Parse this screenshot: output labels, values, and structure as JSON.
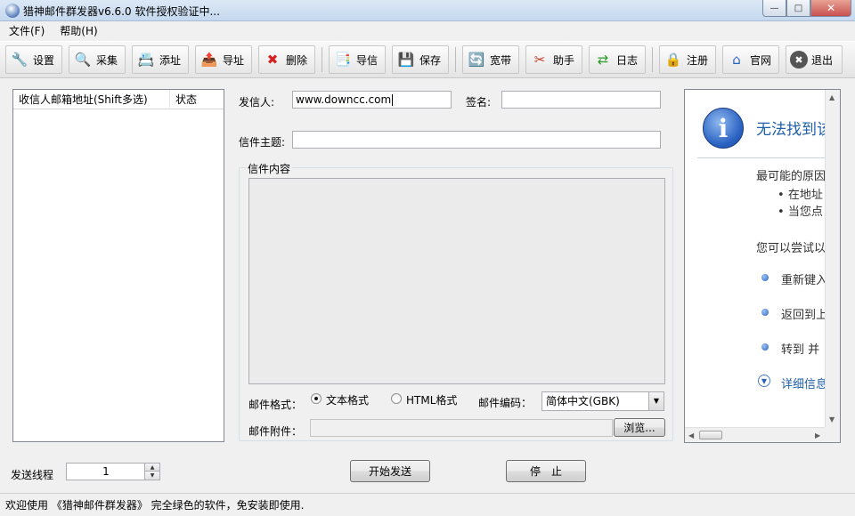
{
  "window": {
    "title": "猎神邮件群发器v6.6.0 软件授权验证中...",
    "controls": {
      "minimize": "—",
      "maximize": "□",
      "close": "✕"
    }
  },
  "menu": [
    "文件(F)",
    "帮助(H)"
  ],
  "toolbar": [
    {
      "label": "设置",
      "icon": "wrench-icon",
      "glyph": "🔧",
      "color": "#5a6b7d"
    },
    {
      "label": "采集",
      "icon": "magnifier-icon",
      "glyph": "🔍",
      "color": "#2a62c2"
    },
    {
      "label": "添址",
      "icon": "add-address-icon",
      "glyph": "📇",
      "color": "#2a62c2"
    },
    {
      "label": "导址",
      "icon": "export-address-icon",
      "glyph": "📤",
      "color": "#2a7d2a"
    },
    {
      "label": "删除",
      "icon": "delete-x-icon",
      "glyph": "✖",
      "color": "#d42020"
    },
    {
      "label": "导信",
      "icon": "import-letter-icon",
      "glyph": "📑",
      "color": "#555"
    },
    {
      "label": "保存",
      "icon": "save-icon",
      "glyph": "💾",
      "color": "#c98a18"
    },
    {
      "label": "宽带",
      "icon": "broadband-refresh-icon",
      "glyph": "🔄",
      "color": "#d98a00"
    },
    {
      "label": "助手",
      "icon": "scissors-icon",
      "glyph": "✂",
      "color": "#c0392b"
    },
    {
      "label": "日志",
      "icon": "log-arrows-icon",
      "glyph": "⇄",
      "color": "#2a9d2a"
    },
    {
      "label": "注册",
      "icon": "lock-icon",
      "glyph": "🔒",
      "color": "#b08a20"
    },
    {
      "label": "官网",
      "icon": "home-icon",
      "glyph": "⌂",
      "color": "#2a62c2"
    },
    {
      "label": "退出",
      "icon": "exit-icon",
      "glyph": "✖",
      "color": "#ffffff"
    }
  ],
  "recipients": {
    "col_address": "收信人邮箱地址(Shift多选)",
    "col_status": "状态"
  },
  "form": {
    "sender_label": "发信人:",
    "sender_value": "www.downcc.com",
    "signature_label": "签名:",
    "signature_value": "",
    "subject_label": "信件主题:",
    "subject_value": "",
    "content_legend": "信件内容",
    "format_label": "邮件格式：",
    "format_text": "文本格式",
    "format_html": "HTML格式",
    "encoding_label": "邮件编码：",
    "encoding_value": "简体中文(GBK)",
    "attachment_label": "邮件附件：",
    "attachment_value": "",
    "browse_button": "浏览..."
  },
  "error_panel": {
    "title": "无法找到该",
    "cause_heading": "最可能的原因",
    "causes": [
      "在地址",
      "当您点"
    ],
    "try_heading": "您可以尝试以",
    "suggestions": [
      "重新键入",
      "返回到上",
      "转到  并"
    ],
    "details_link": "详细信息"
  },
  "bottom": {
    "threads_label": "发送线程",
    "threads_value": "1",
    "start_button": "开始发送",
    "stop_button": "停　止"
  },
  "status": "欢迎使用 《猎神邮件群发器》 完全绿色的软件，免安装即使用."
}
